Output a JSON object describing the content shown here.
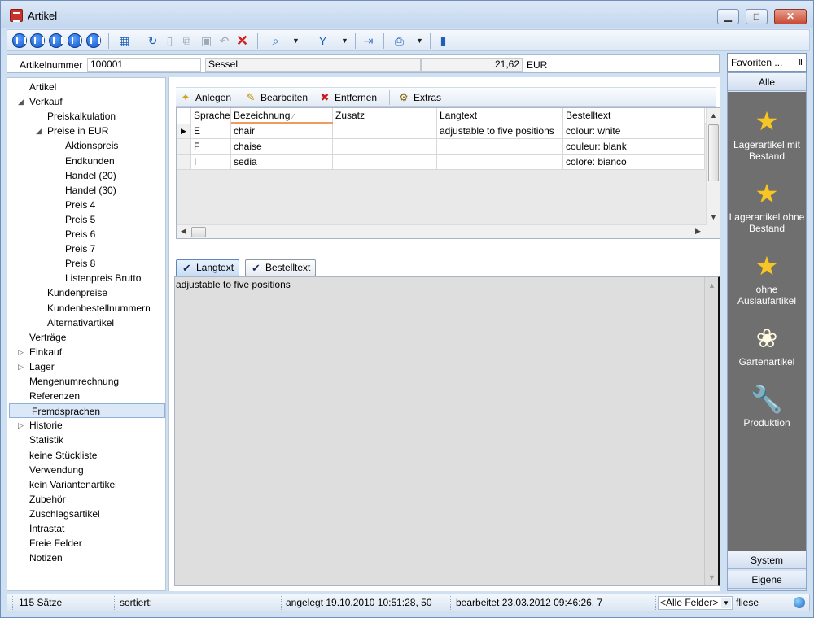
{
  "window": {
    "title": "Artikel",
    "controls": [
      "▁",
      "□",
      "✕"
    ]
  },
  "toolbar": {
    "dropdown_glyph": "▼"
  },
  "record": {
    "label": "Artikelnummer",
    "number": "100001",
    "name": "Sessel",
    "price": "21,62",
    "currency": "EUR"
  },
  "nav": {
    "items": [
      {
        "label": "Artikel"
      },
      {
        "label": "Verkauf",
        "toggle": "◢"
      },
      {
        "label": "Preiskalkulation"
      },
      {
        "label": "Preise in EUR",
        "toggle": "◢"
      },
      {
        "label": "Aktionspreis"
      },
      {
        "label": "Endkunden"
      },
      {
        "label": "Handel (20)"
      },
      {
        "label": "Handel (30)"
      },
      {
        "label": "Preis 4"
      },
      {
        "label": "Preis 5"
      },
      {
        "label": "Preis 6"
      },
      {
        "label": "Preis 7"
      },
      {
        "label": "Preis 8"
      },
      {
        "label": "Listenpreis Brutto"
      },
      {
        "label": "Kundenpreise"
      },
      {
        "label": "Kundenbestellnummern"
      },
      {
        "label": "Alternativartikel"
      },
      {
        "label": "Verträge"
      },
      {
        "label": "Einkauf",
        "toggle": "▷"
      },
      {
        "label": "Lager",
        "toggle": "▷"
      },
      {
        "label": "Mengenumrechnung"
      },
      {
        "label": "Referenzen"
      },
      {
        "label": "Fremdsprachen",
        "selected": true
      },
      {
        "label": "Historie",
        "toggle": "▷"
      },
      {
        "label": "Statistik"
      },
      {
        "label": "keine Stückliste"
      },
      {
        "label": "Verwendung"
      },
      {
        "label": "kein Variantenartikel"
      },
      {
        "label": "Zubehör"
      },
      {
        "label": "Zuschlagsartikel"
      },
      {
        "label": "Intrastat"
      },
      {
        "label": "Freie Felder"
      },
      {
        "label": "Notizen"
      }
    ]
  },
  "actions": {
    "add": "Anlegen",
    "edit": "Bearbeiten",
    "remove": "Entfernen",
    "extras": "Extras"
  },
  "grid": {
    "columns": [
      "Sprache",
      "Bezeichnung",
      "Zusatz",
      "Langtext",
      "Bestelltext"
    ],
    "sort_indicator": "⁄",
    "current_row_marker": "▶",
    "rows": [
      [
        "E",
        "chair",
        "",
        "adjustable to five positions",
        "colour: white"
      ],
      [
        "F",
        "chaise",
        "",
        "",
        "couleur: blank"
      ],
      [
        "I",
        "sedia",
        "",
        "",
        "colore: bianco"
      ]
    ]
  },
  "text_tabs": {
    "tab1": "Langtext",
    "tab2": "Bestelltext",
    "check": "✔"
  },
  "text_content": "adjustable to five positions",
  "favorites": {
    "title": "Favoriten ...",
    "pin": "Ⅱ",
    "tab_all": "Alle",
    "items": [
      {
        "label": "Lagerartikel mit Bestand",
        "icon": "star-icon",
        "glyph": "★"
      },
      {
        "label": "Lagerartikel ohne Bestand",
        "icon": "star-icon",
        "glyph": "★"
      },
      {
        "label": "ohne Auslaufartikel",
        "icon": "star-icon",
        "glyph": "★"
      },
      {
        "label": "Gartenartikel",
        "icon": "flower-icon",
        "glyph": "❀"
      },
      {
        "label": "Produktion",
        "icon": "wrench-icon",
        "glyph": "🔧"
      }
    ],
    "tab_system": "System",
    "tab_own": "Eigene"
  },
  "status": {
    "records": "115 Sätze",
    "sorted": "sortiert:",
    "created": "angelegt 19.10.2010 10:51:28, 50",
    "edited": "bearbeitet 23.03.2012 09:46:26,  7",
    "field_filter": "<Alle Felder>",
    "search_mode": "fliese"
  },
  "colors": {
    "accent": "#1f5fb8",
    "favorites_bg": "#6f6f6f",
    "selection": "#dbe8f8"
  }
}
